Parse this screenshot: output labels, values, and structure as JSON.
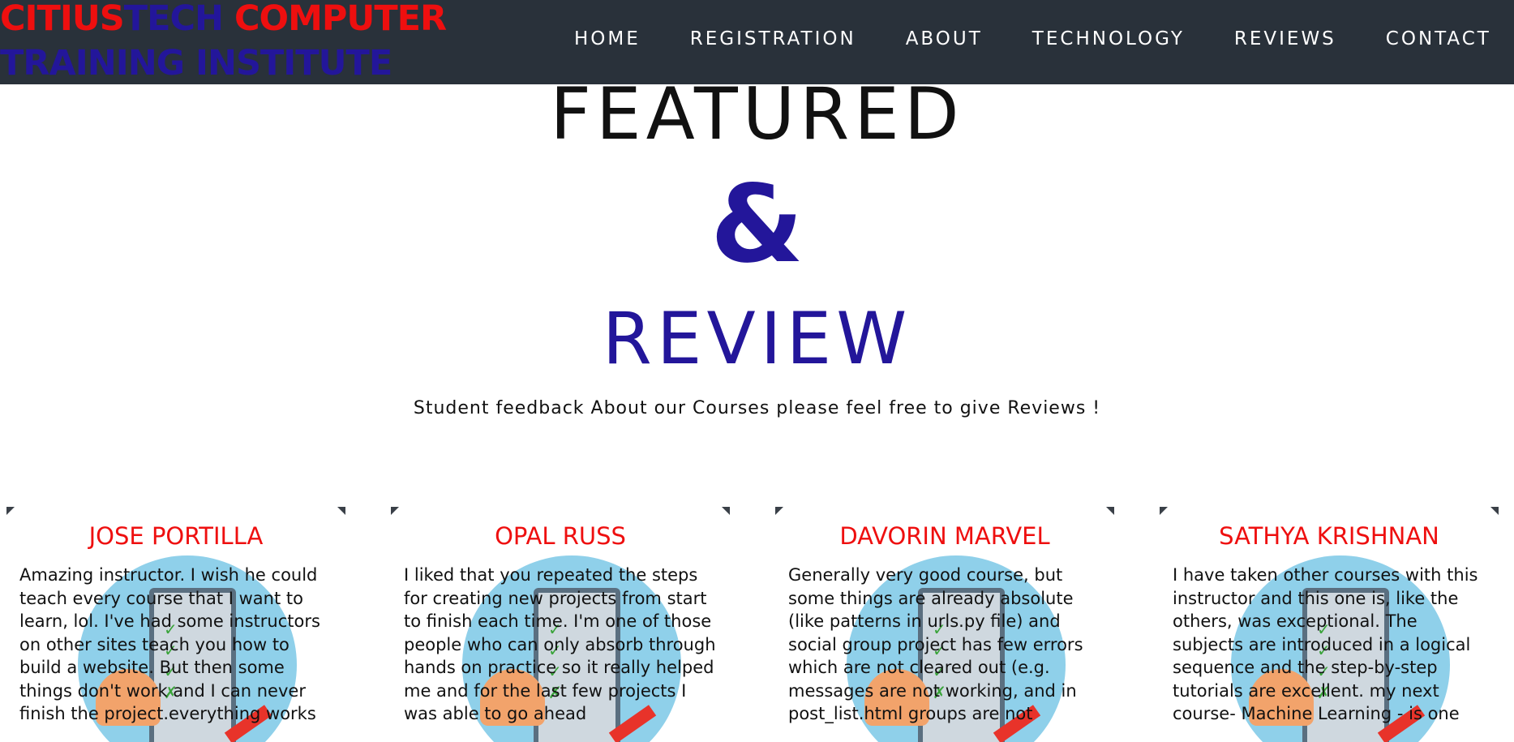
{
  "brand": {
    "line1_part1": "CITIUS",
    "line1_part2": "TECH",
    "line1_part3": " COMPUTER",
    "line2": "TRAINING INSTITUTE"
  },
  "nav": {
    "items": [
      "HOME",
      "REGISTRATION",
      "ABOUT",
      "TECHNOLOGY",
      "REVIEWS",
      "CONTACT"
    ]
  },
  "hero": {
    "featured": "FEATURED",
    "ampersand": "&",
    "review": "REVIEW",
    "subtitle": "Student feedback About our Courses please feel free to give Reviews !"
  },
  "reviews": [
    {
      "name": "JOSE PORTILLA",
      "text": "Amazing instructor. I wish he could teach every course that I want to learn, lol. I've had some instructors on other sites teach you how to build a website. But then some things don't work and I can never finish the project.everything works"
    },
    {
      "name": "OPAL RUSS",
      "text": "I liked that you repeated the steps for creating new projects from start to finish each time. I'm one of those people who can only absorb through hands on practice so it really helped me and for the last few projects I was able to go ahead"
    },
    {
      "name": "DAVORIN MARVEL",
      "text": "Generally very good course, but some things are already absolute (like patterns in urls.py file) and social group project has few errors which are not cleared out (e.g. messages are not working, and in post_list.html groups are not"
    },
    {
      "name": "SATHYA KRISHNAN",
      "text": "I have taken other courses with this instructor and this one is, like the others, was exceptional. The subjects are introduced in a logical sequence and the step-by-step tutorials are excellent. my next course- Machine Learning - is one"
    }
  ],
  "colors": {
    "nav_bg": "#29313a",
    "brand_red": "#ee0f0f",
    "brand_blue": "#23169a",
    "review_name": "#ee0f0f",
    "card_illustration": "#8fd0ea"
  }
}
